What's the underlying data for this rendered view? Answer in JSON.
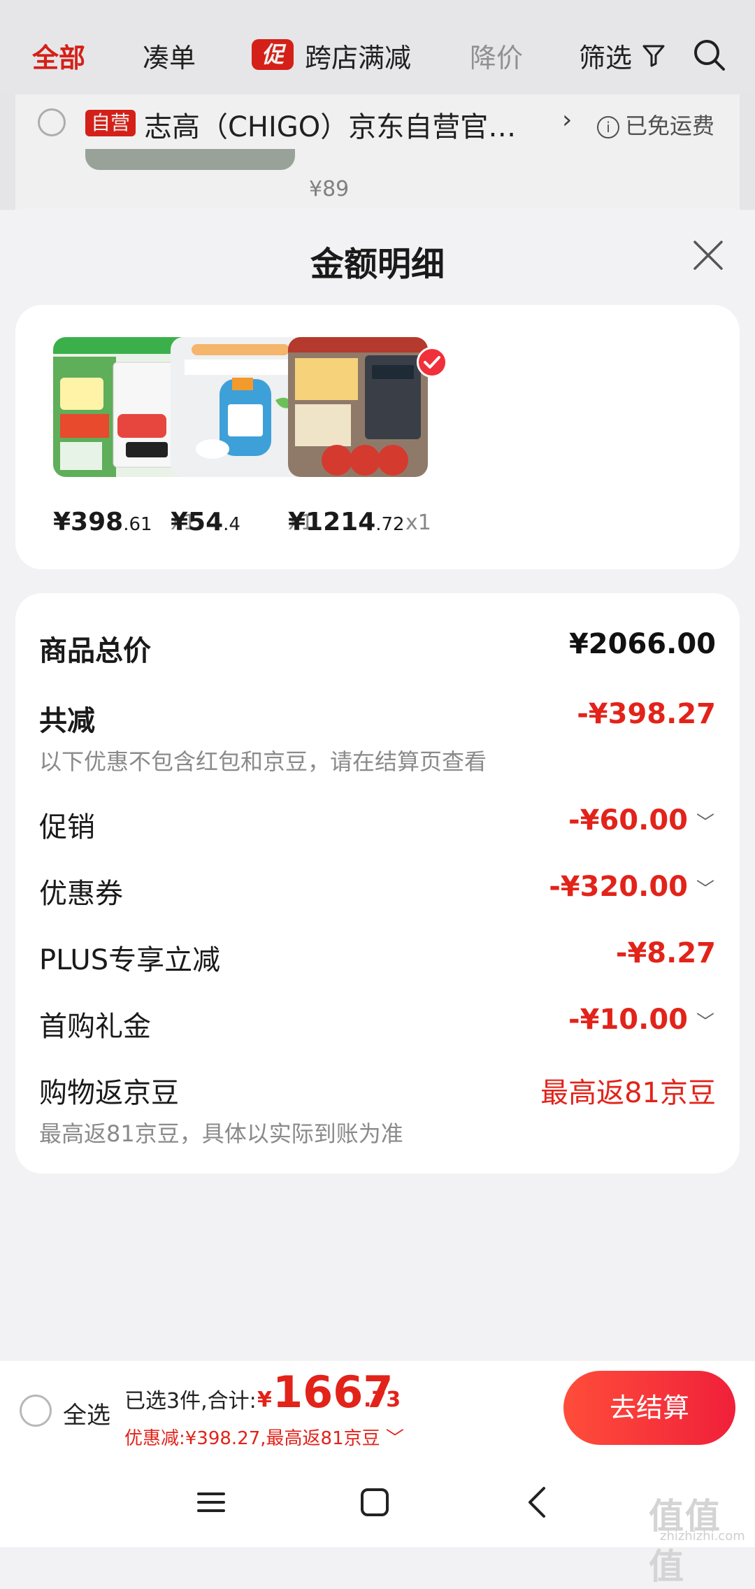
{
  "tabs": {
    "all": "全部",
    "bundle": "凑单",
    "promo_badge": "促",
    "cross_store": "跨店满减",
    "price_drop": "降价",
    "filter": "筛选"
  },
  "store": {
    "badge": "自营",
    "name": "志高（CHIGO）京东自营官…",
    "arrow": "›",
    "shipping": "已免运费",
    "shipping_icon": "i",
    "peek_price": "¥89"
  },
  "sheet": {
    "title": "金额明细"
  },
  "products": [
    {
      "price_int": "¥398",
      "price_dec": ".61",
      "qty": "x1"
    },
    {
      "price_int": "¥54",
      "price_dec": ".4",
      "qty": "x1"
    },
    {
      "price_int": "¥1214",
      "price_dec": ".72",
      "qty": "x1"
    }
  ],
  "summary": {
    "total_label": "商品总价",
    "total_value": "¥2066.00",
    "discount_label": "共减",
    "discount_value": "-¥398.27",
    "discount_note": "以下优惠不包含红包和京豆，请在结算页查看",
    "promo_label": "促销",
    "promo_value": "-¥60.00",
    "coupon_label": "优惠券",
    "coupon_value": "-¥320.00",
    "plus_label": "PLUS专享立减",
    "plus_value": "-¥8.27",
    "gift_label": "首购礼金",
    "gift_value": "-¥10.00",
    "beans_label": "购物返京豆",
    "beans_value": "最高返81京豆",
    "beans_note": "最高返81京豆，具体以实际到账为准",
    "chevron": "﹀"
  },
  "checkout": {
    "select_all": "全选",
    "selected": "已选3件,合计:",
    "currency": "¥",
    "total_int": "1667",
    "total_dec": ".73",
    "discount_line": "优惠减:¥398.27,最高返81京豆 ﹀",
    "button": "去结算"
  },
  "watermark": {
    "logo": "值值值",
    "site": "zhizhizhi.com"
  }
}
